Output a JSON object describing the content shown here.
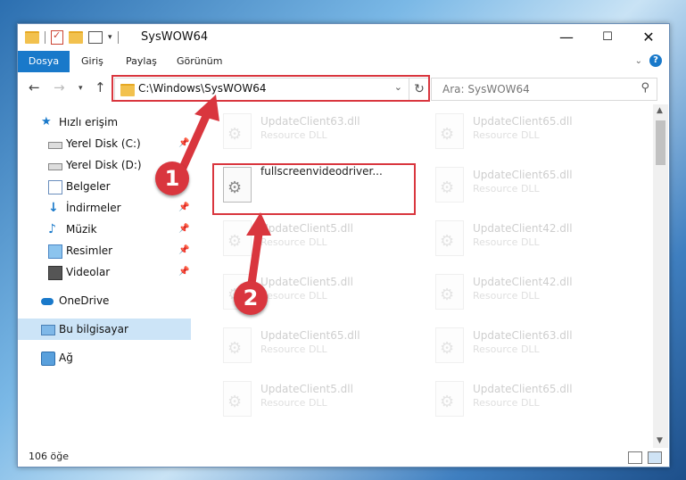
{
  "window": {
    "title": "SysWOW64",
    "minimize": "—",
    "maximize": "☐",
    "close": "✕"
  },
  "ribbon": {
    "tabs": [
      "Dosya",
      "Giriş",
      "Paylaş",
      "Görünüm"
    ],
    "help": "?"
  },
  "address": {
    "path": "C:\\Windows\\SysWOW64",
    "search_placeholder": "Ara: SysWOW64"
  },
  "nav": {
    "items": [
      {
        "label": "Hızlı erişim",
        "icon": "star-icon"
      },
      {
        "label": "Yerel Disk (C:)",
        "icon": "drive-icon"
      },
      {
        "label": "Yerel Disk (D:)",
        "icon": "drive-icon"
      },
      {
        "label": "Belgeler",
        "icon": "documents-icon"
      },
      {
        "label": "İndirmeler",
        "icon": "downloads-icon"
      },
      {
        "label": "Müzik",
        "icon": "music-icon"
      },
      {
        "label": "Resimler",
        "icon": "pictures-icon"
      },
      {
        "label": "Videolar",
        "icon": "videos-icon"
      },
      {
        "label": "OneDrive",
        "icon": "cloud-icon"
      },
      {
        "label": "Bu bilgisayar",
        "icon": "computer-icon"
      },
      {
        "label": "Ağ",
        "icon": "network-icon"
      }
    ]
  },
  "files": {
    "highlighted": {
      "name": "fullscreenvideodriver..."
    },
    "background": [
      {
        "name": "UpdateClient63.dll",
        "desc": "Resource DLL"
      },
      {
        "name": "UpdateClient65.dll",
        "desc": "Resource DLL"
      },
      {
        "name": "UpdateClient65.dll",
        "desc": "Resource DLL"
      },
      {
        "name": "UpdateClient5.dll",
        "desc": "Resource DLL"
      },
      {
        "name": "UpdateClient42.dll",
        "desc": "Resource DLL"
      },
      {
        "name": "UpdateClient5.dll",
        "desc": "Resource DLL"
      },
      {
        "name": "UpdateClient42.dll",
        "desc": "Resource DLL"
      },
      {
        "name": "UpdateClient65.dll",
        "desc": "Resource DLL"
      },
      {
        "name": "UpdateClient63.dll",
        "desc": "Resource DLL"
      },
      {
        "name": "UpdateClient5.dll",
        "desc": "Resource DLL"
      },
      {
        "name": "UpdateClient65.dll",
        "desc": "Resource DLL"
      }
    ]
  },
  "status": {
    "count": "106 öğe"
  },
  "annotations": {
    "step1": "1",
    "step2": "2"
  },
  "colors": {
    "accent": "#1979ca",
    "annotation_red": "#d9363e"
  }
}
